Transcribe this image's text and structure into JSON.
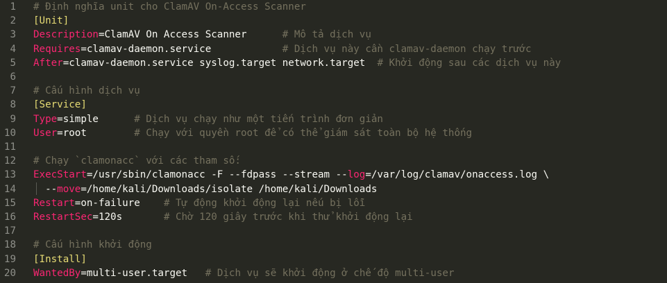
{
  "lines": [
    {
      "num": "1",
      "comment": "# Định nghĩa unit cho ClamAV On-Access Scanner"
    },
    {
      "num": "2",
      "section": "[Unit]"
    },
    {
      "num": "3",
      "key": "Description",
      "value": "ClamAV On Access Scanner      ",
      "comment": "# Mô tả dịch vụ"
    },
    {
      "num": "4",
      "key": "Requires",
      "value": "clamav-daemon.service            ",
      "comment": "# Dịch vụ này cần clamav-daemon chạy trước"
    },
    {
      "num": "5",
      "key": "After",
      "value": "clamav-daemon.service syslog.target network.target  ",
      "comment": "# Khởi động sau các dịch vụ này"
    },
    {
      "num": "6"
    },
    {
      "num": "7",
      "comment": "# Cấu hình dịch vụ"
    },
    {
      "num": "8",
      "section": "[Service]"
    },
    {
      "num": "9",
      "key": "Type",
      "value": "simple      ",
      "comment": "# Dịch vụ chạy như một tiến trình đơn giản"
    },
    {
      "num": "10",
      "key": "User",
      "value": "root        ",
      "comment": "# Chạy với quyền root để có thể giám sát toàn bộ hệ thống"
    },
    {
      "num": "11"
    },
    {
      "num": "12",
      "comment": "# Chạy `clamonacc` với các tham số:"
    },
    {
      "num": "13",
      "key": "ExecStart",
      "value": "/usr/sbin/clamonacc -F --fdpass --stream --",
      "key2": "log",
      "value2": "/var/log/clamav/onaccess.log \\"
    },
    {
      "num": "14",
      "prefix": "  --",
      "key": "move",
      "value": "/home/kali/Downloads/isolate /home/kali/Downloads"
    },
    {
      "num": "15",
      "key": "Restart",
      "value": "on-failure    ",
      "comment": "# Tự động khởi động lại nếu bị lỗi"
    },
    {
      "num": "16",
      "key": "RestartSec",
      "value": "120s       ",
      "comment": "# Chờ 120 giây trước khi thử khởi động lại"
    },
    {
      "num": "17"
    },
    {
      "num": "18",
      "comment": "# Cấu hình khởi động"
    },
    {
      "num": "19",
      "section": "[Install]"
    },
    {
      "num": "20",
      "key": "WantedBy",
      "value": "multi-user.target   ",
      "comment": "# Dịch vụ sẽ khởi động ở chế độ multi-user"
    }
  ],
  "colors": {
    "background": "#272822",
    "line_number": "#8f908a",
    "comment": "#75715e",
    "section": "#e6db74",
    "key": "#f92672",
    "text": "#f8f8f2"
  }
}
